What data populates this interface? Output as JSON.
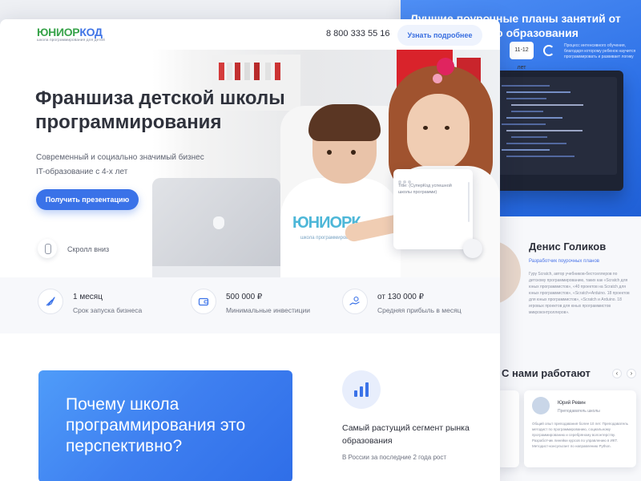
{
  "background_page": {
    "hero_title": "Лучшие поурочные планы занятий от инновационного образования",
    "badge": "11-12 лет",
    "hero_note": "Процесс интенсивного обучения, благодаря которому ребенок научится программировать и развивает логику",
    "person": {
      "name": "Денис Голиков",
      "role": "Разработчик поурочных планов",
      "bio": "Гуру Scratch, автор учебников-бестселлеров по детскому программированию, таких как «Scratch для юных программистов», «40 проектов на Scratch для юных программистов», «Scratch+Arduino. 18 проектов для юных программистов», «Scratch и Arduino. 18 игровых проектов для юных программистов микроконтроллеров»."
    },
    "section_title": "С нами работают",
    "nav_prev": "‹",
    "nav_next": "›",
    "card": {
      "name": "Юрий Ревин",
      "role": "Преподаватель школы",
      "text": "Общий опыт преподавания более 10 лет. Преподаватель методист по программированию, социальному программированию и серебряному волонтерству. Разработчик линейки курсов по управлению в ИКТ. Методист-консультант по направлению Python."
    }
  },
  "header": {
    "logo_part1": "ЮНИОР",
    "logo_part2": "КОД",
    "logo_sub": "школа программирования для детей",
    "phone": "8 800 333 55 16",
    "cta": "Узнать подробнее"
  },
  "hero": {
    "title": "Франшиза детской школы программирования",
    "subtitle_line1": "Современный и социально значимый бизнес",
    "subtitle_line2": "IT-образование с 4-х лет",
    "button": "Получить презентацию",
    "scroll": "Скролл вниз",
    "shirt_logo": "ЮНИОРК",
    "shirt_sub": "школа программирования",
    "code_card_text": "Title: (СуперКод успешной школы программи)"
  },
  "stats": [
    {
      "value": "1 месяц",
      "label": "Срок запуска бизнеса",
      "icon": "rocket-icon"
    },
    {
      "value": "500 000 ₽",
      "label": "Минимальные инвестиции",
      "icon": "wallet-icon"
    },
    {
      "value": "от 130 000 ₽",
      "label": "Средняя прибыль в месяц",
      "icon": "hand-coin-icon"
    }
  ],
  "why": {
    "title": "Почему школа программирования это перспективно?"
  },
  "segment": {
    "title": "Самый растущий сегмент рынка образования",
    "text": "В России за последние 2 года рост",
    "icon": "bar-chart-icon"
  },
  "colors": {
    "accent": "#3a72e8",
    "logo_green": "#38a34a",
    "logo_blue": "#3f74e6",
    "text_dark": "#2f323c"
  }
}
